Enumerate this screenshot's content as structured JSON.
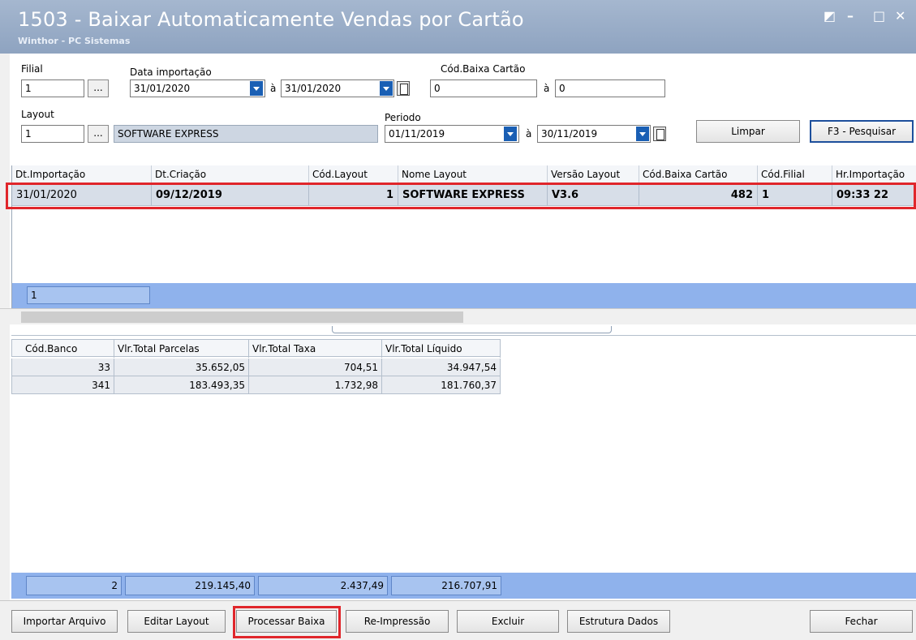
{
  "window": {
    "title": "1503 - Baixar Automaticamente Vendas por Cartão",
    "subtitle": "Winthor - PC Sistemas",
    "controls": {
      "restore": "◩",
      "minimize": "–",
      "maximize": "□",
      "close": "✕"
    }
  },
  "filters": {
    "filial": {
      "label": "Filial",
      "value": "1",
      "ellipsis": "..."
    },
    "data_importacao": {
      "label": "Data importação",
      "from": "31/01/2020",
      "sep": "à",
      "to": "31/01/2020"
    },
    "cod_baixa": {
      "label": "Cód.Baixa Cartão",
      "from": "0",
      "sep": "à",
      "to": "0"
    },
    "layout": {
      "label": "Layout",
      "value": "1",
      "ellipsis": "...",
      "name": "SOFTWARE EXPRESS"
    },
    "periodo": {
      "label": "Periodo",
      "from": "01/11/2019",
      "sep": "à",
      "to": "30/11/2019"
    },
    "limpar_label": "Limpar",
    "pesquisar_label": "F3 - Pesquisar"
  },
  "grid_main": {
    "columns": [
      "Dt.Importação",
      "Dt.Criação",
      "Cód.Layout",
      "Nome Layout",
      "Versão Layout",
      "Cód.Baixa Cartão",
      "Cód.Filial",
      "Hr.Importação"
    ],
    "rows": [
      [
        "31/01/2020",
        "09/12/2019",
        "1",
        "SOFTWARE EXPRESS",
        "V3.6",
        "482",
        "1",
        "09:33 22"
      ]
    ],
    "footer_count": "1"
  },
  "grid_detail": {
    "columns": [
      "Cód.Banco",
      "Vlr.Total Parcelas",
      "Vlr.Total Taxa",
      "Vlr.Total Líquido"
    ],
    "rows": [
      [
        "33",
        "35.652,05",
        "704,51",
        "34.947,54"
      ],
      [
        "341",
        "183.493,35",
        "1.732,98",
        "181.760,37"
      ]
    ],
    "footer": [
      "2",
      "219.145,40",
      "2.437,49",
      "216.707,91"
    ]
  },
  "actions": {
    "importar": "Importar Arquivo",
    "editar": "Editar Layout",
    "processar": "Processar Baixa",
    "reimpressao": "Re-Impressão",
    "excluir": "Excluir",
    "estrutura": "Estrutura Dados",
    "fechar": "Fechar"
  },
  "colors": {
    "titlebar": "#8ea3c0",
    "footer_band": "#8fb2ec",
    "highlight": "#e0262b",
    "dropdown": "#1a5fb4"
  }
}
